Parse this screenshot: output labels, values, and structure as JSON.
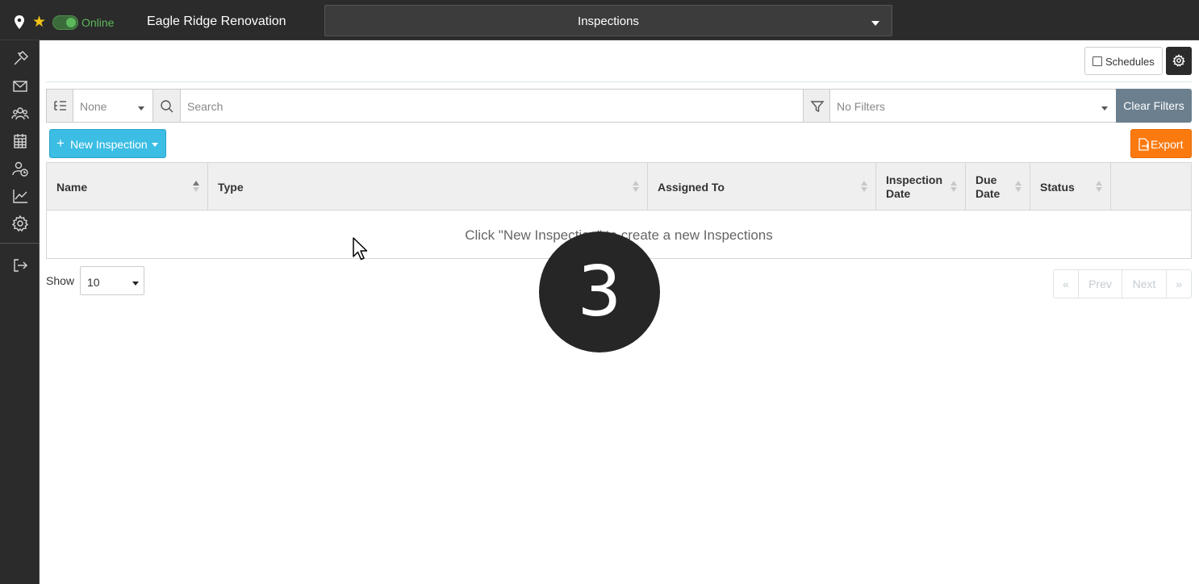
{
  "topbar": {
    "status_label": "Online",
    "project_name": "Eagle Ridge Renovation",
    "module_selected": "Inspections"
  },
  "sidebar": {
    "items": [
      {
        "icon": "hammer-icon"
      },
      {
        "icon": "mail-icon"
      },
      {
        "icon": "users-icon"
      },
      {
        "icon": "calendar-icon"
      },
      {
        "icon": "user-clock-icon"
      },
      {
        "icon": "chart-line-icon"
      },
      {
        "icon": "gear-icon"
      },
      {
        "icon": "logout-icon"
      }
    ]
  },
  "header": {
    "schedules_label": "Schedules"
  },
  "filterbar": {
    "group_value": "None",
    "search_placeholder": "Search",
    "filters_value": "No Filters",
    "clear_label": "Clear Filters"
  },
  "actions": {
    "new_label": "New Inspection",
    "export_label": "Export"
  },
  "table": {
    "columns": [
      {
        "label": "Name"
      },
      {
        "label": "Type"
      },
      {
        "label": "Assigned To"
      },
      {
        "label_line1": "Inspection",
        "label_line2": "Date"
      },
      {
        "label_line1": "Due",
        "label_line2": "Date"
      },
      {
        "label": "Status"
      }
    ],
    "empty_message": "Click \"New Inspection\" to create a new Inspections"
  },
  "footer": {
    "show_label": "Show",
    "page_size": "10",
    "pager": {
      "first": "«",
      "prev": "Prev",
      "next": "Next",
      "last": "»"
    }
  },
  "overlay": {
    "step_number": "3"
  },
  "colors": {
    "topbar_bg": "#2b2b2b",
    "online_green": "#5cb85c",
    "new_button": "#3bbde4",
    "export_button": "#fb7a10",
    "clear_filters": "#6b7f8e"
  }
}
